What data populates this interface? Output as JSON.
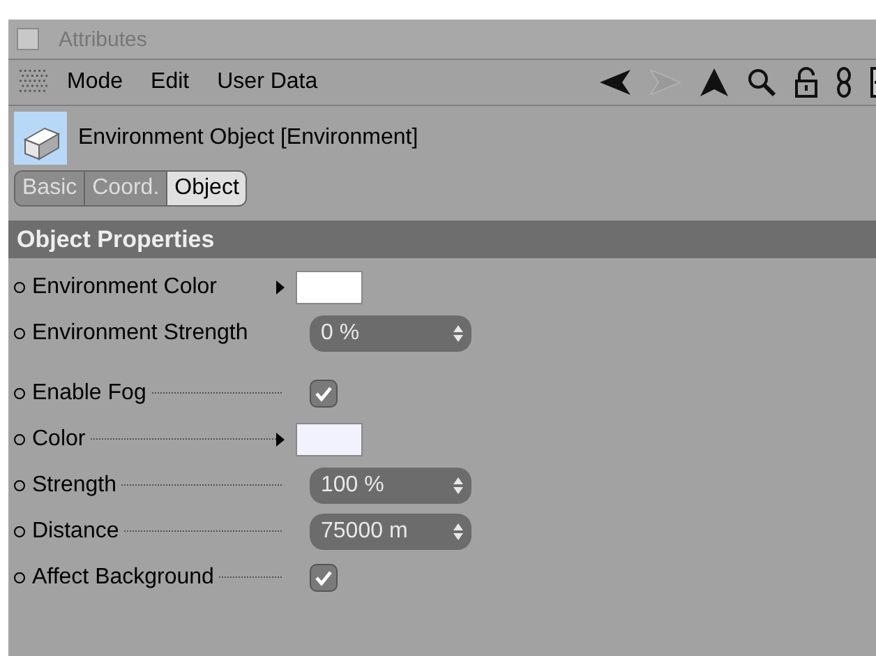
{
  "window": {
    "title": "Attributes"
  },
  "menu": [
    "Mode",
    "Edit",
    "User Data"
  ],
  "object": {
    "title": "Environment Object [Environment]"
  },
  "tabs": [
    {
      "label": "Basic",
      "selected": false
    },
    {
      "label": "Coord.",
      "selected": false
    },
    {
      "label": "Object",
      "selected": true
    }
  ],
  "section": {
    "title": "Object Properties"
  },
  "groups": [
    [
      {
        "kind": "color",
        "label": "Environment Color",
        "dotted": false,
        "color": "#ffffff"
      },
      {
        "kind": "number",
        "label": "Environment Strength",
        "dotted": false,
        "value": "0 %"
      }
    ],
    [
      {
        "kind": "checkbox",
        "label": "Enable Fog",
        "dotted": true,
        "checked": true
      },
      {
        "kind": "color",
        "label": "Color",
        "dotted": true,
        "color": "#f2f2ff"
      },
      {
        "kind": "number",
        "label": "Strength",
        "dotted": true,
        "value": "100 %"
      },
      {
        "kind": "number",
        "label": "Distance",
        "dotted": true,
        "value": "75000 m"
      },
      {
        "kind": "checkbox",
        "label": "Affect Background",
        "dotted": true,
        "checked": true
      }
    ]
  ]
}
